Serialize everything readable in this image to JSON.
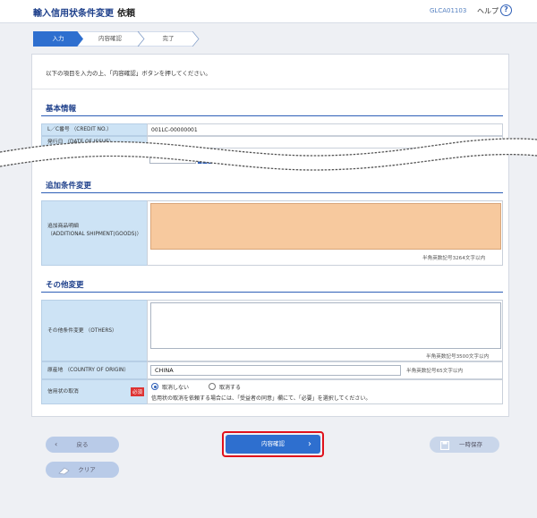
{
  "header": {
    "title": "輸入信用状条件変更",
    "subtitle": "依頼",
    "screen_code": "GLCA01103",
    "help_label": "ヘルプ",
    "help_icon": "?"
  },
  "steps": [
    "入力",
    "内容確認",
    "完了"
  ],
  "intro": "以下の項目を入力の上、「内容確認」ボタンを押してください。",
  "basic_info": {
    "title": "基本情報",
    "lc_label": "L／C番号 （CREDIT NO.）",
    "lc_value": "001LC-00000001",
    "issue_label": "発行日 （DATE OF ISSUE）"
  },
  "additional": {
    "title": "追加条件変更",
    "goods_label_1": "追加商品明細",
    "goods_label_2": "（ADDITIONAL SHIPMENT(GOODS)）",
    "goods_note": "半角英数記号3264文字以内"
  },
  "other": {
    "title": "その他変更",
    "others_label": "その他条件変更 （OTHERS）",
    "others_note": "半角英数記号3500文字以内",
    "origin_label": "原産地 （COUNTRY OF ORIGIN）",
    "origin_value": "CHINA",
    "origin_note": "半角英数記号65文字以内",
    "cancel_label": "信用状の取消",
    "required": "必須",
    "radio_no": "取消しない",
    "radio_yes": "取消する",
    "cancel_note": "信用状の取消を依頼する場合には、「受益者の同意」欄にて、「必要」を選択してください。"
  },
  "buttons": {
    "back": "戻る",
    "confirm": "内容確認",
    "save": "一時保存",
    "clear": "クリア"
  }
}
